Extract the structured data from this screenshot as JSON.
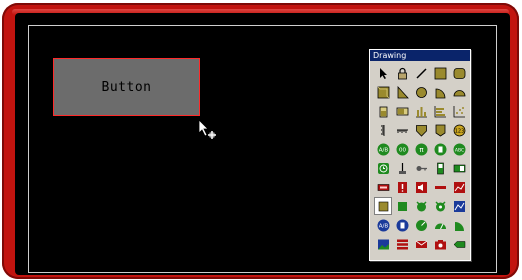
{
  "canvas_button": {
    "label": "Button"
  },
  "palette": {
    "title": "Drawing",
    "tools": [
      {
        "icon": "pointer-icon"
      },
      {
        "icon": "lock-icon"
      },
      {
        "icon": "line-icon"
      },
      {
        "icon": "rectangle-icon"
      },
      {
        "icon": "rounded-rectangle-icon"
      },
      {
        "icon": "box-3d-icon"
      },
      {
        "icon": "triangle-icon"
      },
      {
        "icon": "circle-icon"
      },
      {
        "icon": "quarter-circle-icon"
      },
      {
        "icon": "half-circle-icon"
      },
      {
        "icon": "battery-icon"
      },
      {
        "icon": "slider-icon"
      },
      {
        "icon": "bar-chart-icon"
      },
      {
        "icon": "stacked-bar-icon"
      },
      {
        "icon": "scatter-icon"
      },
      {
        "icon": "vertical-scale-icon"
      },
      {
        "icon": "horizontal-scale-icon"
      },
      {
        "icon": "shield-icon"
      },
      {
        "icon": "tag-icon"
      },
      {
        "icon": "numeric-display-icon"
      },
      {
        "icon": "alpha-button-icon"
      },
      {
        "icon": "round-display-icon"
      },
      {
        "icon": "pi-button-icon"
      },
      {
        "icon": "trash-button-icon"
      },
      {
        "icon": "abc-button-icon"
      },
      {
        "icon": "clock-icon"
      },
      {
        "icon": "lever-icon"
      },
      {
        "icon": "key-icon"
      },
      {
        "icon": "tall-switch-icon"
      },
      {
        "icon": "toggle-switch-icon"
      },
      {
        "icon": "red-label-icon"
      },
      {
        "icon": "alarm-icon"
      },
      {
        "icon": "speaker-icon"
      },
      {
        "icon": "red-bar-icon"
      },
      {
        "icon": "trend-chart-icon"
      },
      {
        "icon": "panel-icon"
      },
      {
        "icon": "green-block-icon"
      },
      {
        "icon": "alarm-bell-icon"
      },
      {
        "icon": "bell-icon"
      },
      {
        "icon": "line-graph-icon"
      },
      {
        "icon": "blue-label-icon"
      },
      {
        "icon": "blue-trash-icon"
      },
      {
        "icon": "gauge-icon"
      },
      {
        "icon": "meter-icon"
      },
      {
        "icon": "dial-icon"
      },
      {
        "icon": "image-icon"
      },
      {
        "icon": "red-stack-icon"
      },
      {
        "icon": "mail-icon"
      },
      {
        "icon": "camera-icon"
      },
      {
        "icon": "pencil-icon"
      }
    ]
  },
  "colors": {
    "frame": "#c2140f",
    "screen": "#000000",
    "button_fill": "#6c6c6c",
    "button_border": "#ff2a2a",
    "palette_title": "#0a246a"
  }
}
